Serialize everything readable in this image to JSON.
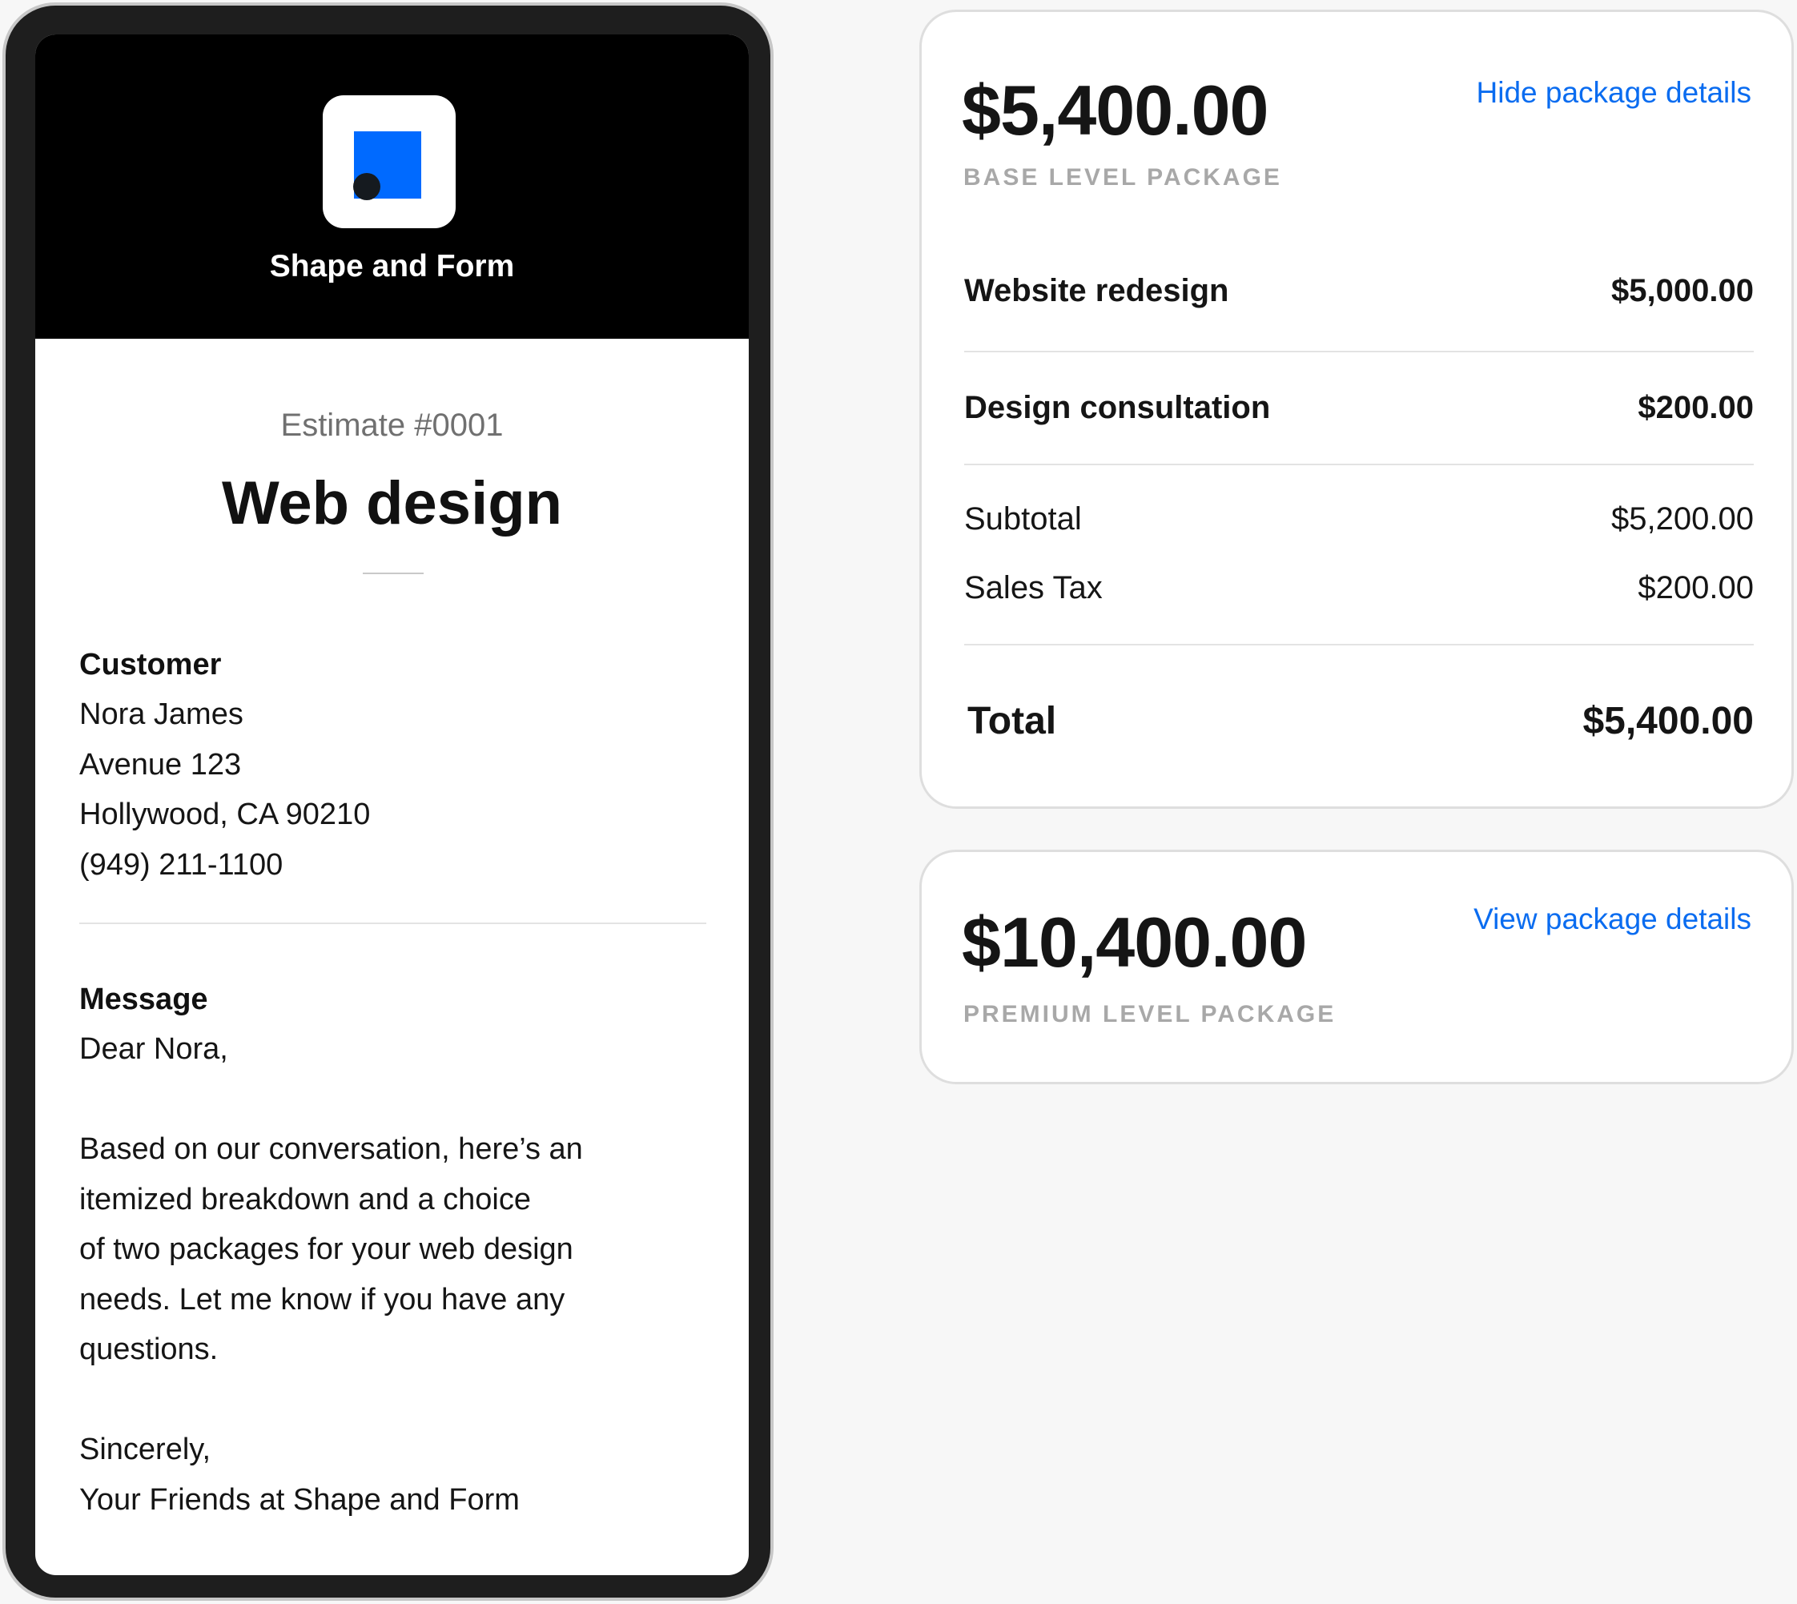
{
  "brand": {
    "name": "Shape and Form",
    "logo_icon": "shape-and-form-logo-icon",
    "accent_color": "#006aff"
  },
  "estimate": {
    "number": "Estimate #0001",
    "title": "Web design"
  },
  "customer": {
    "heading": "Customer",
    "lines": [
      "Nora James",
      "Avenue 123",
      "Hollywood, CA 90210",
      "(949) 211-1100"
    ]
  },
  "message": {
    "heading": "Message",
    "lines": [
      "Dear Nora,",
      "Based on our conversation, here’s an",
      "itemized breakdown and a choice",
      "of two packages for your web design",
      "needs. Let me know if you have any",
      "questions.",
      "Sincerely,",
      "Your Friends at Shape and Form"
    ]
  },
  "packages": [
    {
      "price": "$5,400.00",
      "level": "BASE LEVEL PACKAGE",
      "toggle_label": "Hide package details",
      "items": [
        {
          "name": "Website redesign",
          "amount": "$5,000.00"
        },
        {
          "name": "Design consultation",
          "amount": "$200.00"
        }
      ],
      "subtotal_label": "Subtotal",
      "subtotal": "$5,200.00",
      "tax_label": "Sales Tax",
      "tax": "$200.00",
      "total_label": "Total",
      "total": "$5,400.00"
    },
    {
      "price": "$10,400.00",
      "level": "PREMIUM LEVEL PACKAGE",
      "toggle_label": "View package details"
    }
  ],
  "link_color": "#0a6cf0"
}
